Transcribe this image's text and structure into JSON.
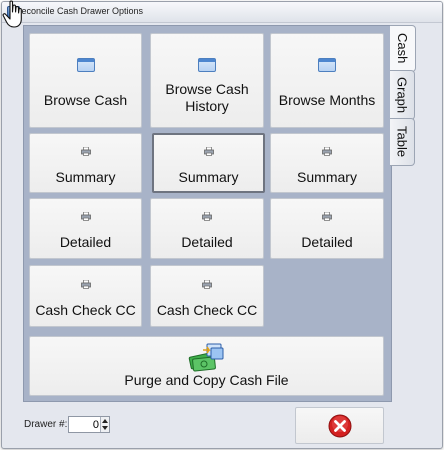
{
  "window": {
    "title": "Reconcile Cash Drawer Options"
  },
  "tabs": [
    {
      "label": "Cash",
      "active": true
    },
    {
      "label": "Graph",
      "active": false
    },
    {
      "label": "Table",
      "active": false
    }
  ],
  "buttons": {
    "browse_cash": "Browse Cash",
    "browse_cash_history": "Browse Cash History",
    "browse_months": "Browse Months",
    "summary_1": "Summary",
    "summary_2": "Summary",
    "summary_3": "Summary",
    "detailed_1": "Detailed",
    "detailed_2": "Detailed",
    "detailed_3": "Detailed",
    "cash_check_cc_1": "Cash Check CC",
    "cash_check_cc_2": "Cash Check CC",
    "purge_copy": "Purge and Copy Cash File"
  },
  "footer": {
    "drawer_label": "Drawer #:",
    "drawer_value": "0"
  },
  "icons": {
    "browse": "window-icon",
    "report": "printer-icon",
    "purge": "money-copy-icon",
    "close": "red-x-icon",
    "cursor": "hand-cursor-icon"
  },
  "colors": {
    "panel": "#a8b3c8",
    "close_red": "#d32020",
    "purge_green": "#2f9a3a"
  }
}
